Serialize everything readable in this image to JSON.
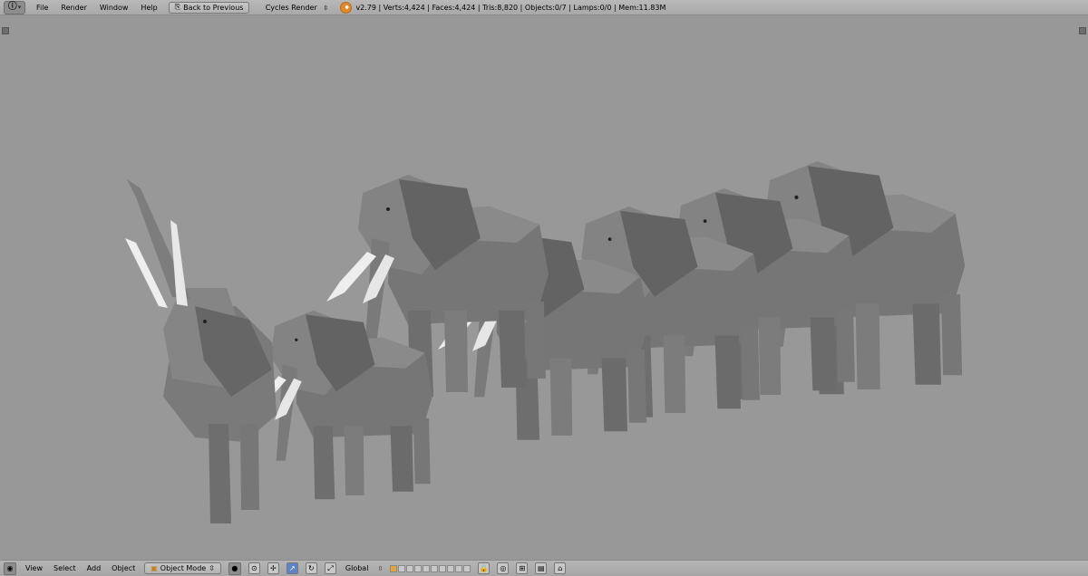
{
  "topbar": {
    "menus": [
      "File",
      "Render",
      "Window",
      "Help"
    ],
    "back_button": "Back to Previous",
    "render_engine": "Cycles Render",
    "stats": "v2.79 | Verts:4,424 | Faces:4,424 | Tris:8,820 | Objects:0/7 | Lamps:0/0 | Mem:11.83M"
  },
  "bottombar": {
    "menus": [
      "View",
      "Select",
      "Add",
      "Object"
    ],
    "mode": "Object Mode",
    "orientation": "Global"
  },
  "icons": {
    "editor_type": "info-icon",
    "mode_icon": "cube-icon",
    "viewport_shading": "sphere-icon"
  },
  "colors": {
    "viewport_bg": "#989898",
    "header_bg": "#b0b0b0",
    "elephant_body": "#787878",
    "elephant_light": "#8c8c8c",
    "elephant_dark": "#5f5f5f",
    "tusk": "#eeeeee"
  }
}
